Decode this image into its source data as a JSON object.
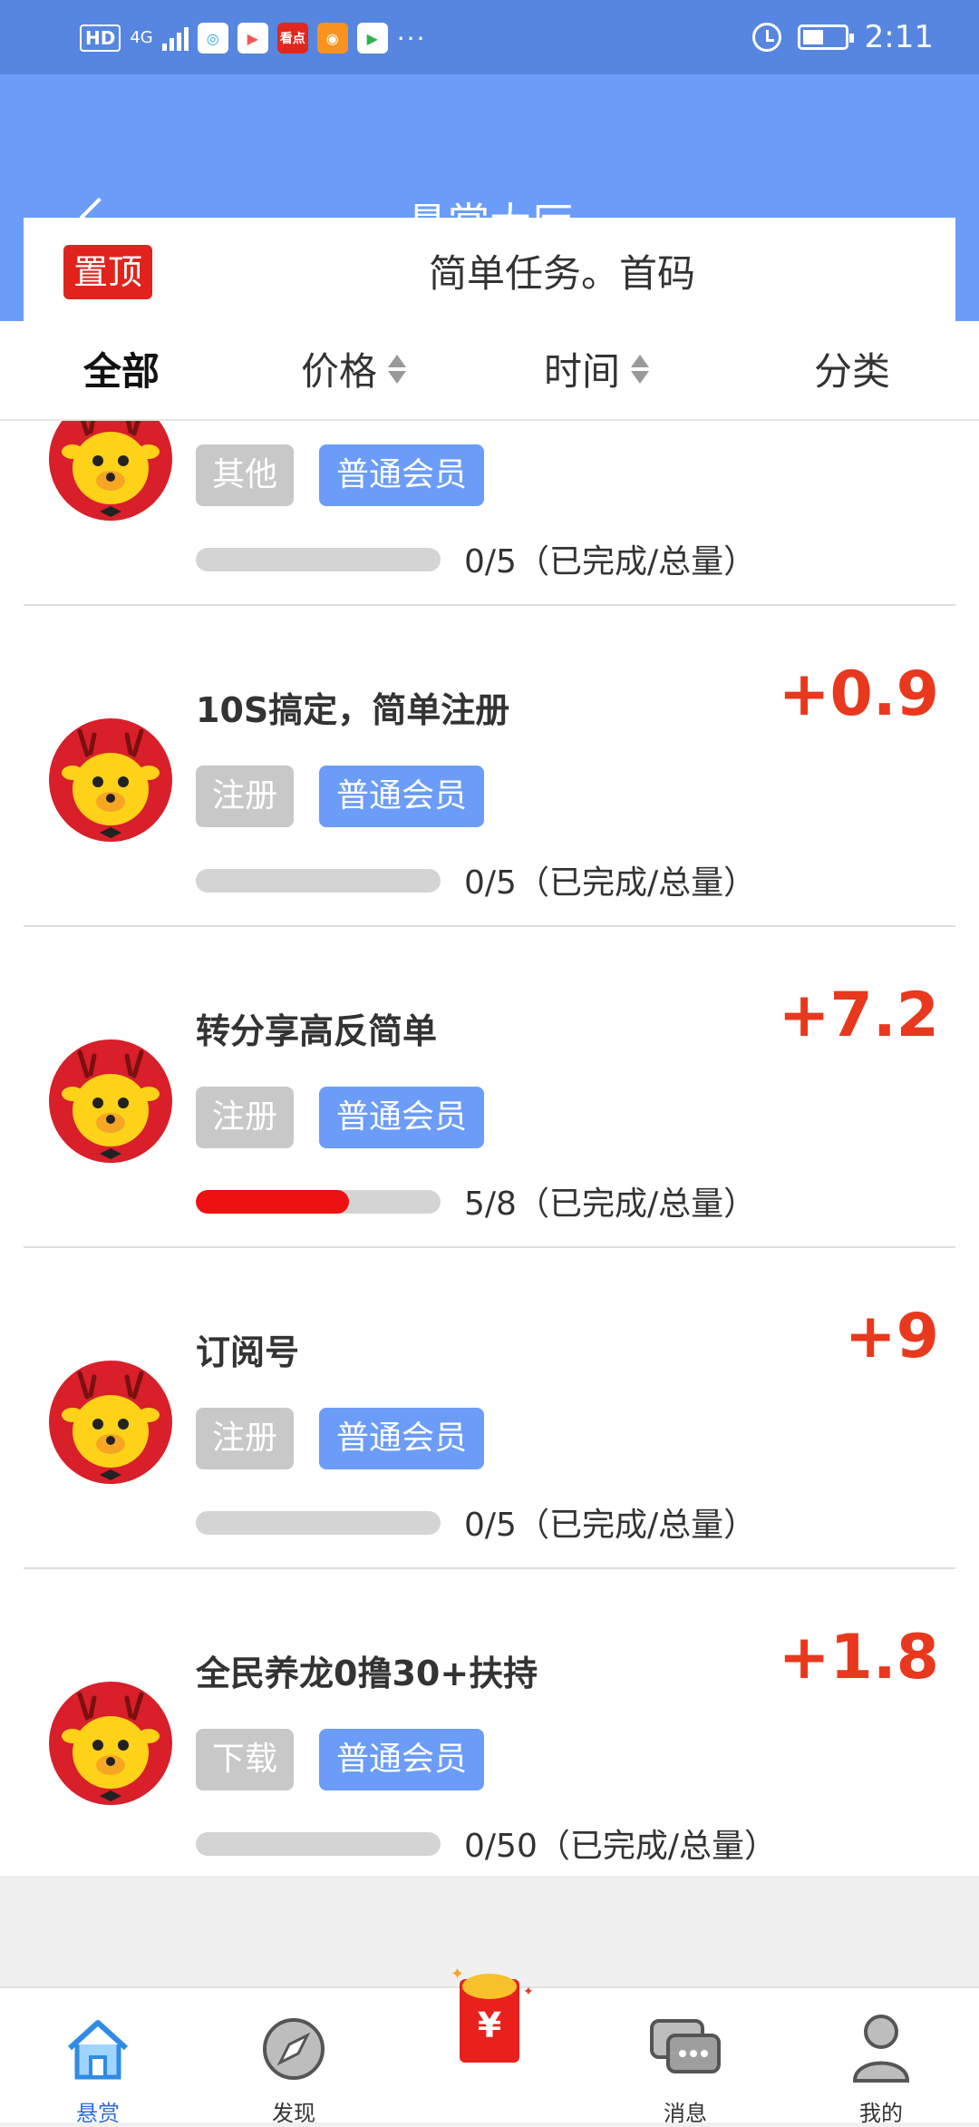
{
  "status_bar": {
    "hd": "HD",
    "network": "4G",
    "app_icons": [
      "qq-browser-icon",
      "video-play-icon",
      "kandian-icon",
      "weibo-icon",
      "play-icon"
    ],
    "app_labels": [
      "",
      "",
      "看点",
      "",
      ""
    ],
    "more": "···",
    "time": "2:11"
  },
  "header": {
    "title": "悬赏大厅"
  },
  "notice": {
    "badge": "置顶",
    "text": "简单任务。首码"
  },
  "filters": [
    {
      "label": "全部",
      "active": true,
      "sortable": false
    },
    {
      "label": "价格",
      "active": false,
      "sortable": true
    },
    {
      "label": "时间",
      "active": false,
      "sortable": true
    },
    {
      "label": "分类",
      "active": false,
      "sortable": false
    }
  ],
  "tasks": [
    {
      "title": "",
      "reward": "",
      "category": "其他",
      "level": "普通会员",
      "progress_text": "0/5（已完成/总量）",
      "progress": 0
    },
    {
      "title": "10S搞定，简单注册",
      "reward": "+0.9",
      "category": "注册",
      "level": "普通会员",
      "progress_text": "0/5（已完成/总量）",
      "progress": 0
    },
    {
      "title": "转分享高反简单",
      "reward": "+7.2",
      "category": "注册",
      "level": "普通会员",
      "progress_text": "5/8（已完成/总量）",
      "progress": 0.625
    },
    {
      "title": "订阅号",
      "reward": "+9",
      "category": "注册",
      "level": "普通会员",
      "progress_text": "0/5（已完成/总量）",
      "progress": 0
    },
    {
      "title": "全民养龙0撸30+扶持",
      "reward": "+1.8",
      "category": "下载",
      "level": "普通会员",
      "progress_text": "0/50（已完成/总量）",
      "progress": 0
    }
  ],
  "bottom_nav": [
    {
      "label": "悬赏",
      "icon": "home-icon",
      "active": true
    },
    {
      "label": "发现",
      "icon": "compass-icon",
      "active": false
    },
    {
      "label": "",
      "icon": "red-envelope-icon",
      "active": false
    },
    {
      "label": "消息",
      "icon": "chat-icon",
      "active": false
    },
    {
      "label": "我的",
      "icon": "user-icon",
      "active": false
    }
  ],
  "colors": {
    "primary": "#6b9cf8",
    "status_bar": "#5686e0",
    "reward": "#e8381e",
    "tag_gray": "#c8c8c8",
    "progress_fill": "#ee1111"
  }
}
